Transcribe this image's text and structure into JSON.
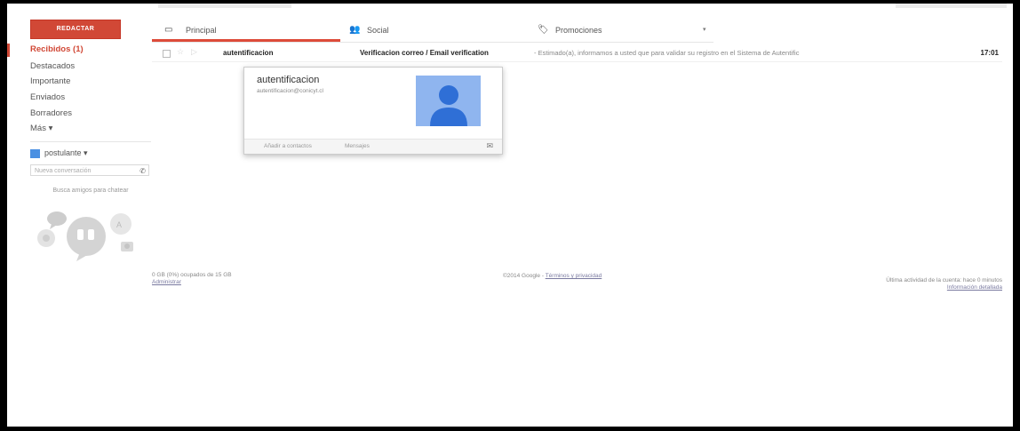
{
  "compose": {
    "label": "REDACTAR"
  },
  "nav": {
    "items": [
      {
        "label": "Recibidos (1)",
        "active": true
      },
      {
        "label": "Destacados"
      },
      {
        "label": "Importante"
      },
      {
        "label": "Enviados"
      },
      {
        "label": "Borradores"
      },
      {
        "label": "Más ▾"
      }
    ]
  },
  "chat": {
    "user": "postulante ▾",
    "search_placeholder": "Nueva conversación",
    "hint": "Busca amigos para chatear"
  },
  "tabs": [
    {
      "label": "Principal",
      "icon": "inbox-icon",
      "active": true
    },
    {
      "label": "Social",
      "icon": "people-icon"
    },
    {
      "label": "Promociones",
      "icon": "tag-icon"
    }
  ],
  "message": {
    "sender": "autentificacion",
    "subject": "Verificacion correo / Email verification",
    "snippet": "- Estimado(a), informamos a usted que para validar su registro en el Sistema de Autentific",
    "time": "17:01"
  },
  "hovercard": {
    "name": "autentificacion",
    "email": "autentificacion@conicyt.cl",
    "add_contact": "Añadir a contactos",
    "messages": "Mensajes"
  },
  "footer": {
    "storage": "0 GB (0%) ocupados de 15 GB",
    "manage": "Administrar",
    "copyright": "©2014 Google -",
    "terms": "Términos y privacidad",
    "activity": "Última actividad de la cuenta: hace 0 minutos",
    "details": "Información detallada"
  },
  "colors": {
    "accent": "#d14836",
    "avatar_bg": "#8fb5ef",
    "avatar_fg": "#2f6fd6"
  }
}
